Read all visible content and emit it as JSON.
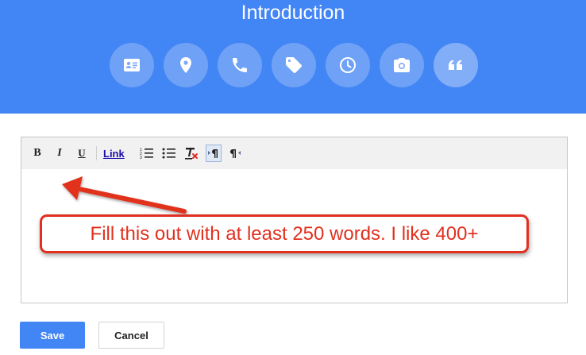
{
  "header": {
    "title": "Introduction",
    "background_color": "#4285f4",
    "categories": [
      {
        "icon": "contact-card-icon"
      },
      {
        "icon": "location-pin-icon"
      },
      {
        "icon": "phone-icon"
      },
      {
        "icon": "tag-icon"
      },
      {
        "icon": "clock-icon"
      },
      {
        "icon": "camera-icon"
      },
      {
        "icon": "quote-icon",
        "selected": true
      }
    ]
  },
  "editor": {
    "toolbar": {
      "bold": "B",
      "italic": "I",
      "underline": "U",
      "link": "Link",
      "icons": [
        "numbered-list-icon",
        "bulleted-list-icon",
        "clear-formatting-icon",
        "ltr-direction-icon",
        "rtl-direction-icon"
      ]
    },
    "body_text": ""
  },
  "annotation": {
    "text": "Fill this out with at least 250 words. I like 400+",
    "color": "#e1301f"
  },
  "actions": {
    "save_label": "Save",
    "cancel_label": "Cancel",
    "save_color": "#4285f4"
  }
}
